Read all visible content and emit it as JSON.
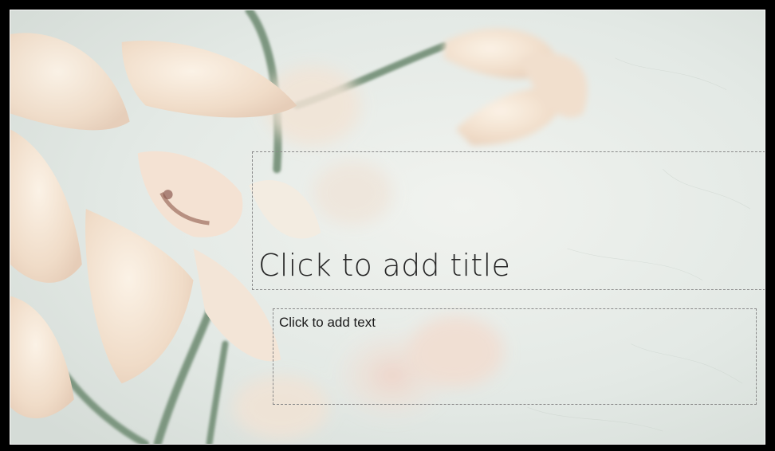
{
  "slide": {
    "title_placeholder": "Click to add title",
    "text_placeholder": "Click to add text",
    "background_image": "orchid-flowers-photo"
  },
  "colors": {
    "frame": "#000000",
    "background": "#e6ebe7",
    "petal": "#f2e2d2",
    "stem": "#6f8a72",
    "title_text": "#262626",
    "placeholder_border": "#8a8a8a"
  }
}
